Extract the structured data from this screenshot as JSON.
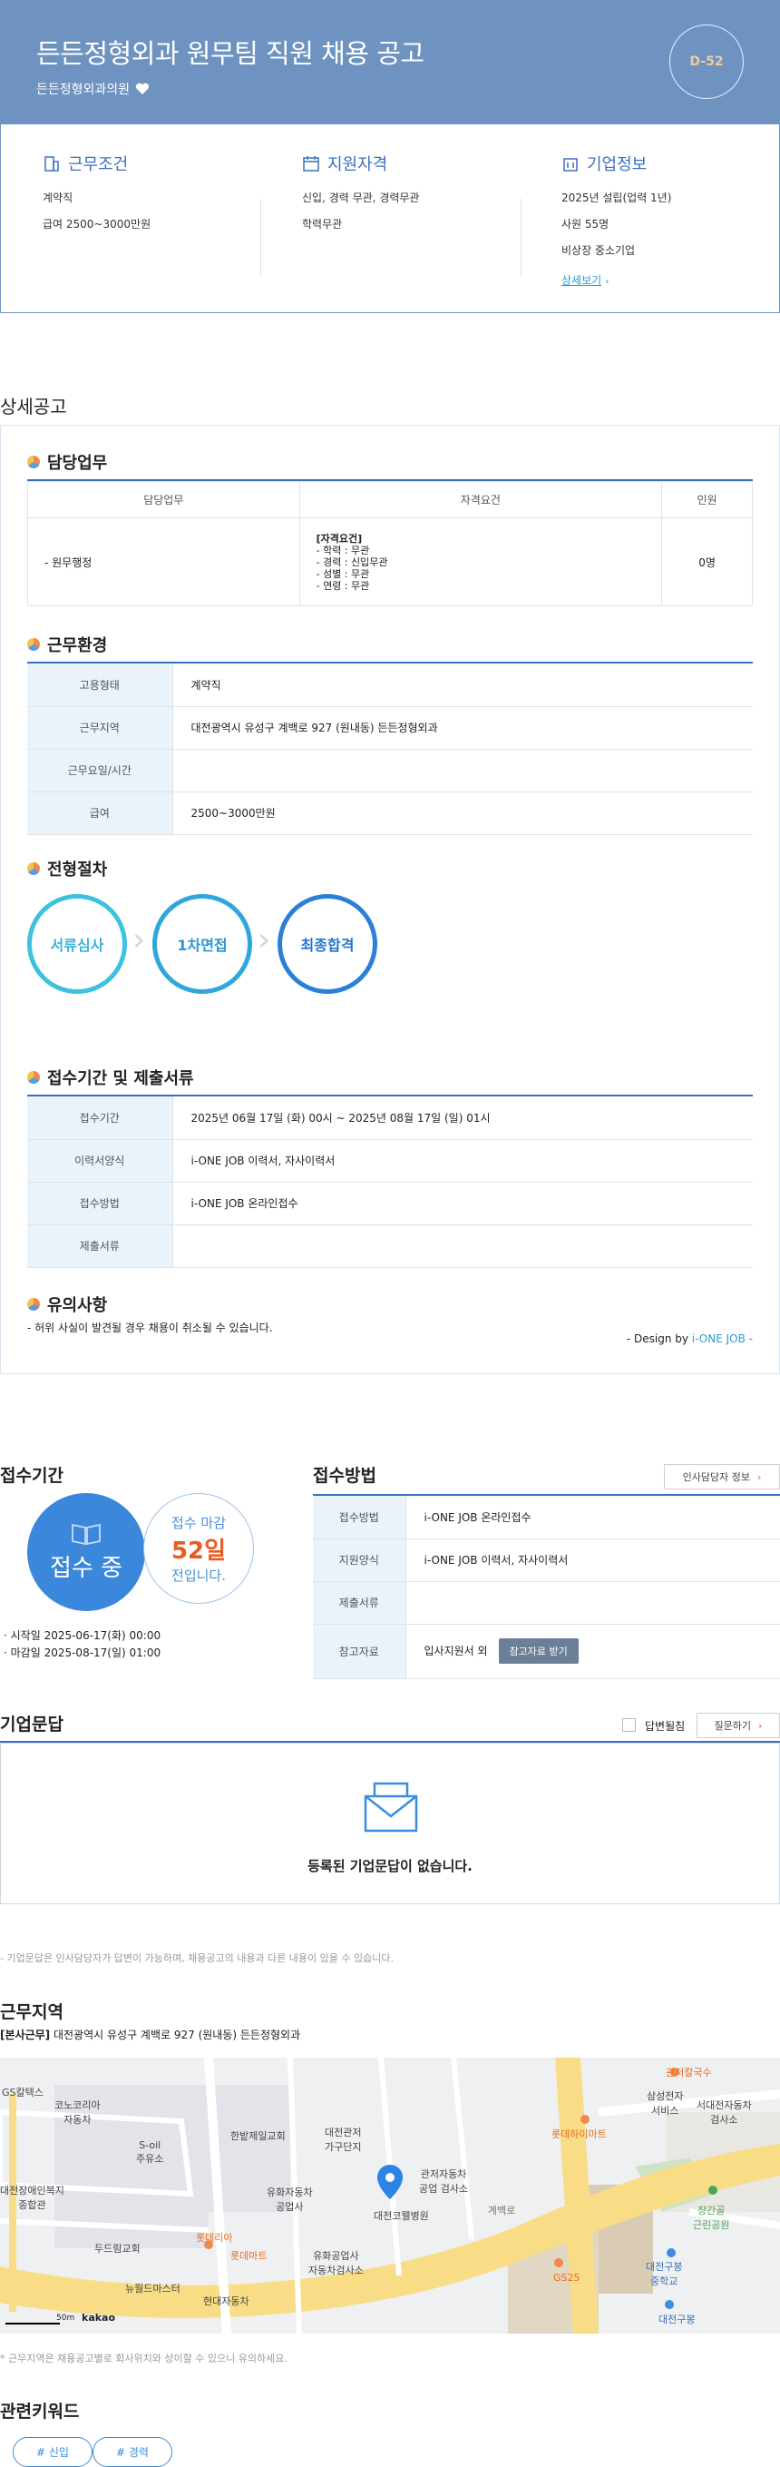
{
  "header": {
    "title": "든든정형외과 원무팀 직원 채용 공고",
    "company": "든든정형외과의원",
    "dday": "D-52"
  },
  "summary": {
    "work": {
      "title": "근무조건",
      "lines": [
        "계약직",
        "급여 2500~3000만원"
      ]
    },
    "qual": {
      "title": "지원자격",
      "lines": [
        "신입, 경력 무관, 경력무관",
        "학력무관"
      ]
    },
    "company": {
      "title": "기업정보",
      "lines": [
        "2025년 설립(업력 1년)",
        "사원 55명",
        "비상장 중소기업"
      ],
      "more": "상세보기"
    }
  },
  "detail": {
    "heading": "상세공고",
    "duty": {
      "title": "담당업무",
      "headers": [
        "담당업무",
        "자격요건",
        "인원"
      ],
      "row": {
        "duty": "- 원무행정",
        "req_title": "[자격요건]",
        "req_lines": [
          "- 학력 : 무관",
          "- 경력 : 신입무관",
          "- 성별 : 무관",
          "- 연령 : 무관"
        ],
        "count": "0명"
      }
    },
    "env": {
      "title": "근무환경",
      "rows": [
        {
          "k": "고용형태",
          "v": "계약직"
        },
        {
          "k": "근무지역",
          "v": "대전광역시 유성구 계백로 927 (원내동) 든든정형외과"
        },
        {
          "k": "근무요일/시간",
          "v": ""
        },
        {
          "k": "급여",
          "v": "2500~3000만원"
        }
      ]
    },
    "process": {
      "title": "전형절차",
      "steps": [
        "서류심사",
        "1차면접",
        "최종합격"
      ]
    },
    "period": {
      "title": "접수기간 및 제출서류",
      "rows": [
        {
          "k": "접수기간",
          "v": "2025년 06월 17일 (화) 00시 ~ 2025년 08월 17일 (일) 01시"
        },
        {
          "k": "이력서양식",
          "v": "i-ONE JOB 이력서, 자사이력서"
        },
        {
          "k": "접수방법",
          "v": "i-ONE JOB 온라인접수"
        },
        {
          "k": "제출서류",
          "v": ""
        }
      ]
    },
    "notice": {
      "title": "유의사항",
      "text": "- 허위 사실이 발견될 경우 채용이 취소될 수 있습니다."
    },
    "design": {
      "prefix": "- Design by ",
      "brand": "i-ONE JOB",
      "suffix": " -"
    }
  },
  "apply_period": {
    "heading": "접수기간",
    "status": "접수 중",
    "deadline_label": "접수 마감",
    "deadline_days": "52일",
    "deadline_suffix": "전입니다.",
    "start": "· 시작일 2025-06-17(화) 00:00",
    "end": "· 마감일 2025-08-17(일) 01:00"
  },
  "apply_method": {
    "heading": "접수방법",
    "hr_button": "인사담당자 정보",
    "rows": [
      {
        "k": "접수방법",
        "v": "i-ONE JOB 온라인접수"
      },
      {
        "k": "지원양식",
        "v": "i-ONE JOB 이력서, 자사이력서"
      },
      {
        "k": "제출서류",
        "v": ""
      },
      {
        "k": "참고자료",
        "v": "입사지원서 외"
      }
    ],
    "download": "참고자료 받기"
  },
  "qa": {
    "heading": "기업문답",
    "checkbox": "답변될침",
    "ask": "질문하기",
    "empty": "등록된 기업문답이 없습니다.",
    "note": "- 기업문답은 인사담당자가 답변이 가능하며, 채용공고의 내용과 다른 내용이 있을 수 있습니다."
  },
  "location": {
    "heading": "근무지역",
    "tag": "[본사근무]",
    "address": "대전광역시 유성구 계백로 927 (원내동) 든든정형외과",
    "note": "* 근무지역은 채용공고별로 회사위치와 상이할 수 있으니 유의하세요.",
    "scale": "50m",
    "map_brand": "kakao",
    "labels": {
      "gs": "GS칼텍스",
      "hifi": "하이마트",
      "sgg": "관저칼국수",
      "ss": "삼성전자\n서비스",
      "kn": "코노코리아\n자동차",
      "hb": "한밭제일교회",
      "dg": "대전관저\n가구단지",
      "soil": "S-oil\n주유소",
      "lotte": "롯데하이마트",
      "sdae": "서대전자동차\n검사소",
      "gj": "관저자동차\n공업 검사소",
      "yh": "유화자동차\n공업사",
      "welfare": "대전장애인복지\n종합관",
      "dd": "두드림교회",
      "lria": "롯데리아",
      "lmart": "롯데마트",
      "dj": "대전코웰병원",
      "yw": "유화공업사\n자동차검사소",
      "nw": "뉴월드마스터",
      "hd": "현대자동차",
      "gb": "계백로",
      "gs25": "GS25",
      "gsp": "장간골\n근린공원",
      "dgm": "대전구봉\n중학교",
      "dgb": "대전구봉"
    }
  },
  "keywords": {
    "heading": "관련키워드",
    "items": [
      "# 신입",
      "# 경력"
    ]
  },
  "colors": {
    "header": "#6f93c1",
    "accent": "#3b6fbf",
    "link": "#2a9ad8",
    "deadline": "#e85c21"
  }
}
